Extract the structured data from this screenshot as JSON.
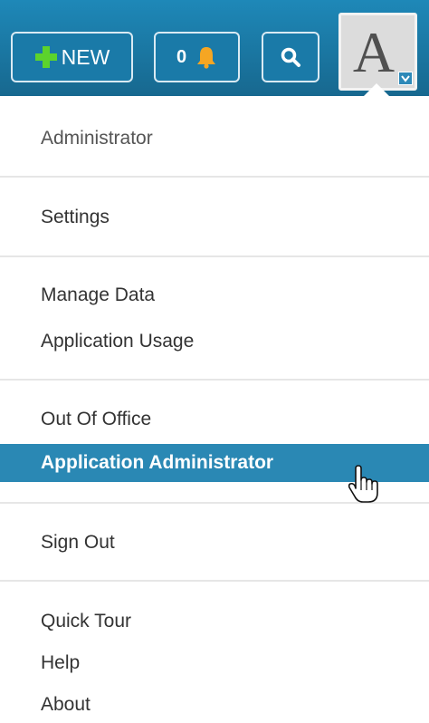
{
  "header": {
    "new_button": {
      "label": "NEW",
      "icon": "plus-icon",
      "icon_color": "#5cd32c"
    },
    "alerts_button": {
      "count": "0",
      "icon": "bell-icon",
      "icon_color": "#f5a623"
    },
    "search_button": {
      "icon": "search-icon"
    },
    "avatar": {
      "letter": "A",
      "icon": "chevron-down-icon"
    },
    "accent_color": "#1e7fb0"
  },
  "menu": {
    "user_name": "Administrator",
    "groups": [
      [
        {
          "label": "Settings"
        }
      ],
      [
        {
          "label": "Manage Data"
        },
        {
          "label": "Application Usage"
        }
      ],
      [
        {
          "label": "Out Of Office"
        },
        {
          "label": "Application Administrator",
          "highlighted": true
        }
      ],
      [
        {
          "label": "Sign Out"
        }
      ],
      [
        {
          "label": "Quick Tour"
        },
        {
          "label": "Help"
        },
        {
          "label": "About"
        }
      ]
    ],
    "highlight_color": "#2a88b4"
  }
}
